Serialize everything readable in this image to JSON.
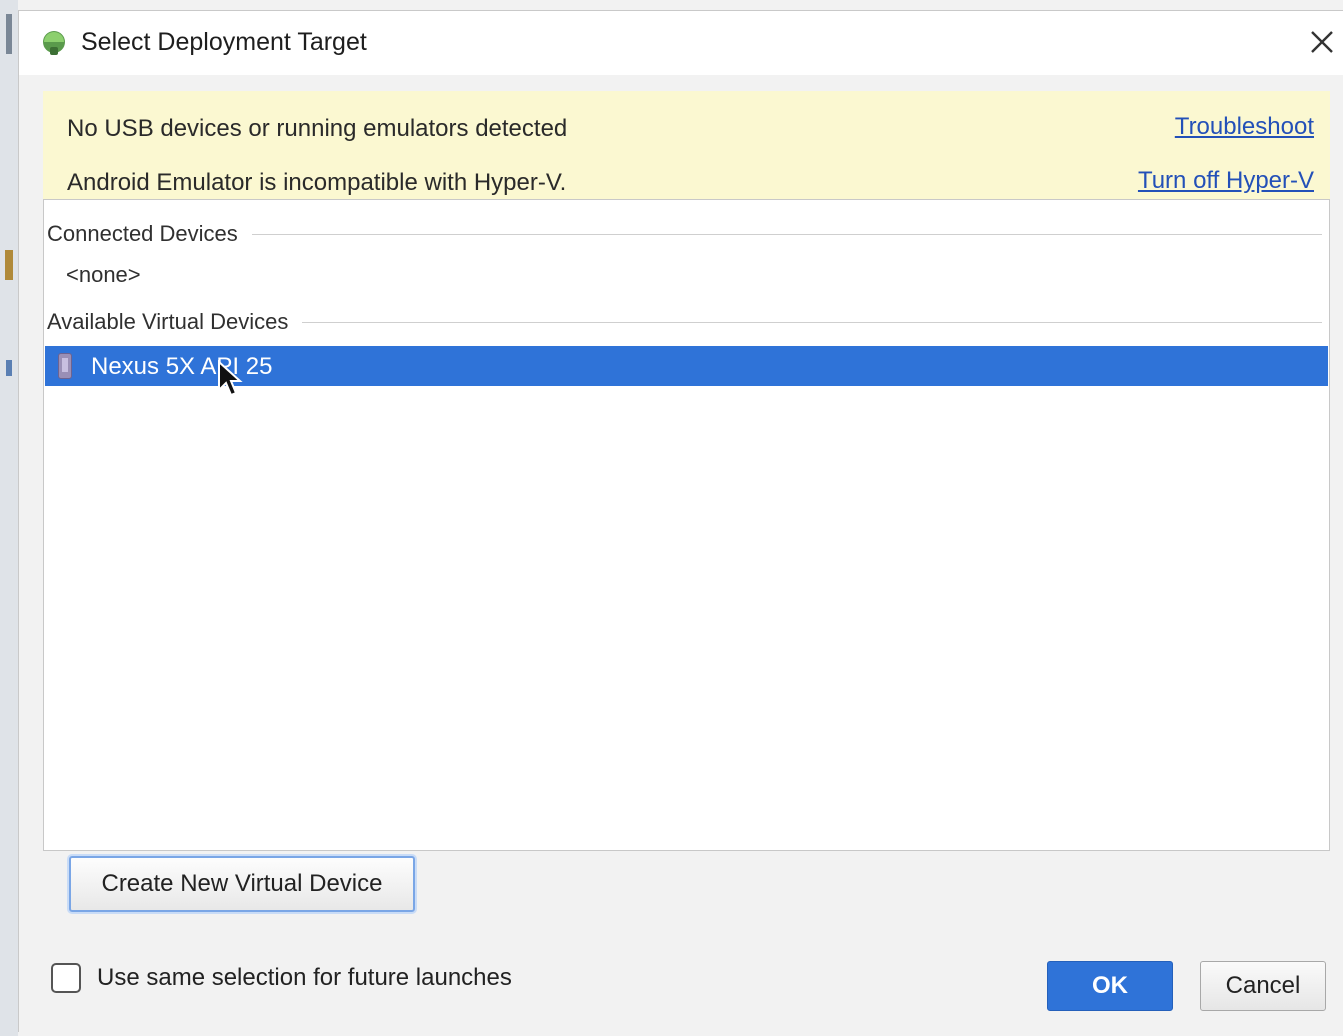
{
  "dialog": {
    "title": "Select Deployment Target",
    "title_icon": "android-studio-icon",
    "close_icon": "close-icon"
  },
  "banner": {
    "message1": "No USB devices or running emulators detected",
    "link1": "Troubleshoot",
    "message2": "Android Emulator is incompatible with Hyper-V.",
    "link2": "Turn off Hyper-V"
  },
  "device_list": {
    "connected_header": "Connected Devices",
    "connected_empty": "<none>",
    "virtual_header": "Available Virtual Devices",
    "virtual_devices": [
      {
        "name": "Nexus 5X API 25",
        "icon": "phone-icon",
        "selected": true
      }
    ]
  },
  "actions": {
    "create_label": "Create New Virtual Device",
    "remember_label": "Use same selection for future launches",
    "remember_checked": false,
    "ok_label": "OK",
    "cancel_label": "Cancel"
  },
  "colors": {
    "accent": "#2f73d8",
    "banner_bg": "#fbf8d1",
    "link": "#2350b8"
  }
}
